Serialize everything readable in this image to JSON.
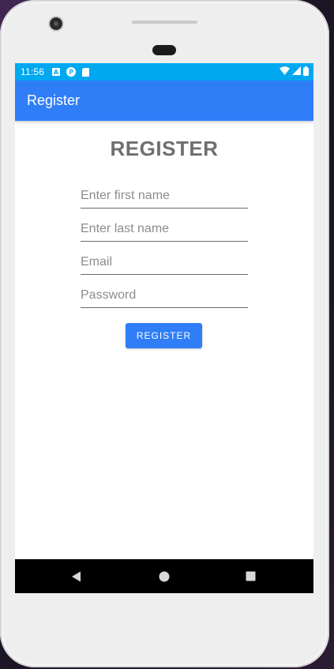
{
  "status_bar": {
    "time": "11:56",
    "icons": [
      "a-notification-icon",
      "p-notification-icon",
      "sd-card-icon",
      "wifi-icon",
      "signal-icon",
      "battery-icon"
    ],
    "color": "#00a8f0"
  },
  "app_bar": {
    "title": "Register",
    "color": "#2f7ef8"
  },
  "form": {
    "heading": "REGISTER",
    "first_name_placeholder": "Enter first name",
    "last_name_placeholder": "Enter last name",
    "email_placeholder": "Email",
    "password_placeholder": "Password",
    "submit_label": "REGISTER"
  },
  "nav_bar": {
    "buttons": [
      "back-icon",
      "home-icon",
      "recents-icon"
    ]
  }
}
